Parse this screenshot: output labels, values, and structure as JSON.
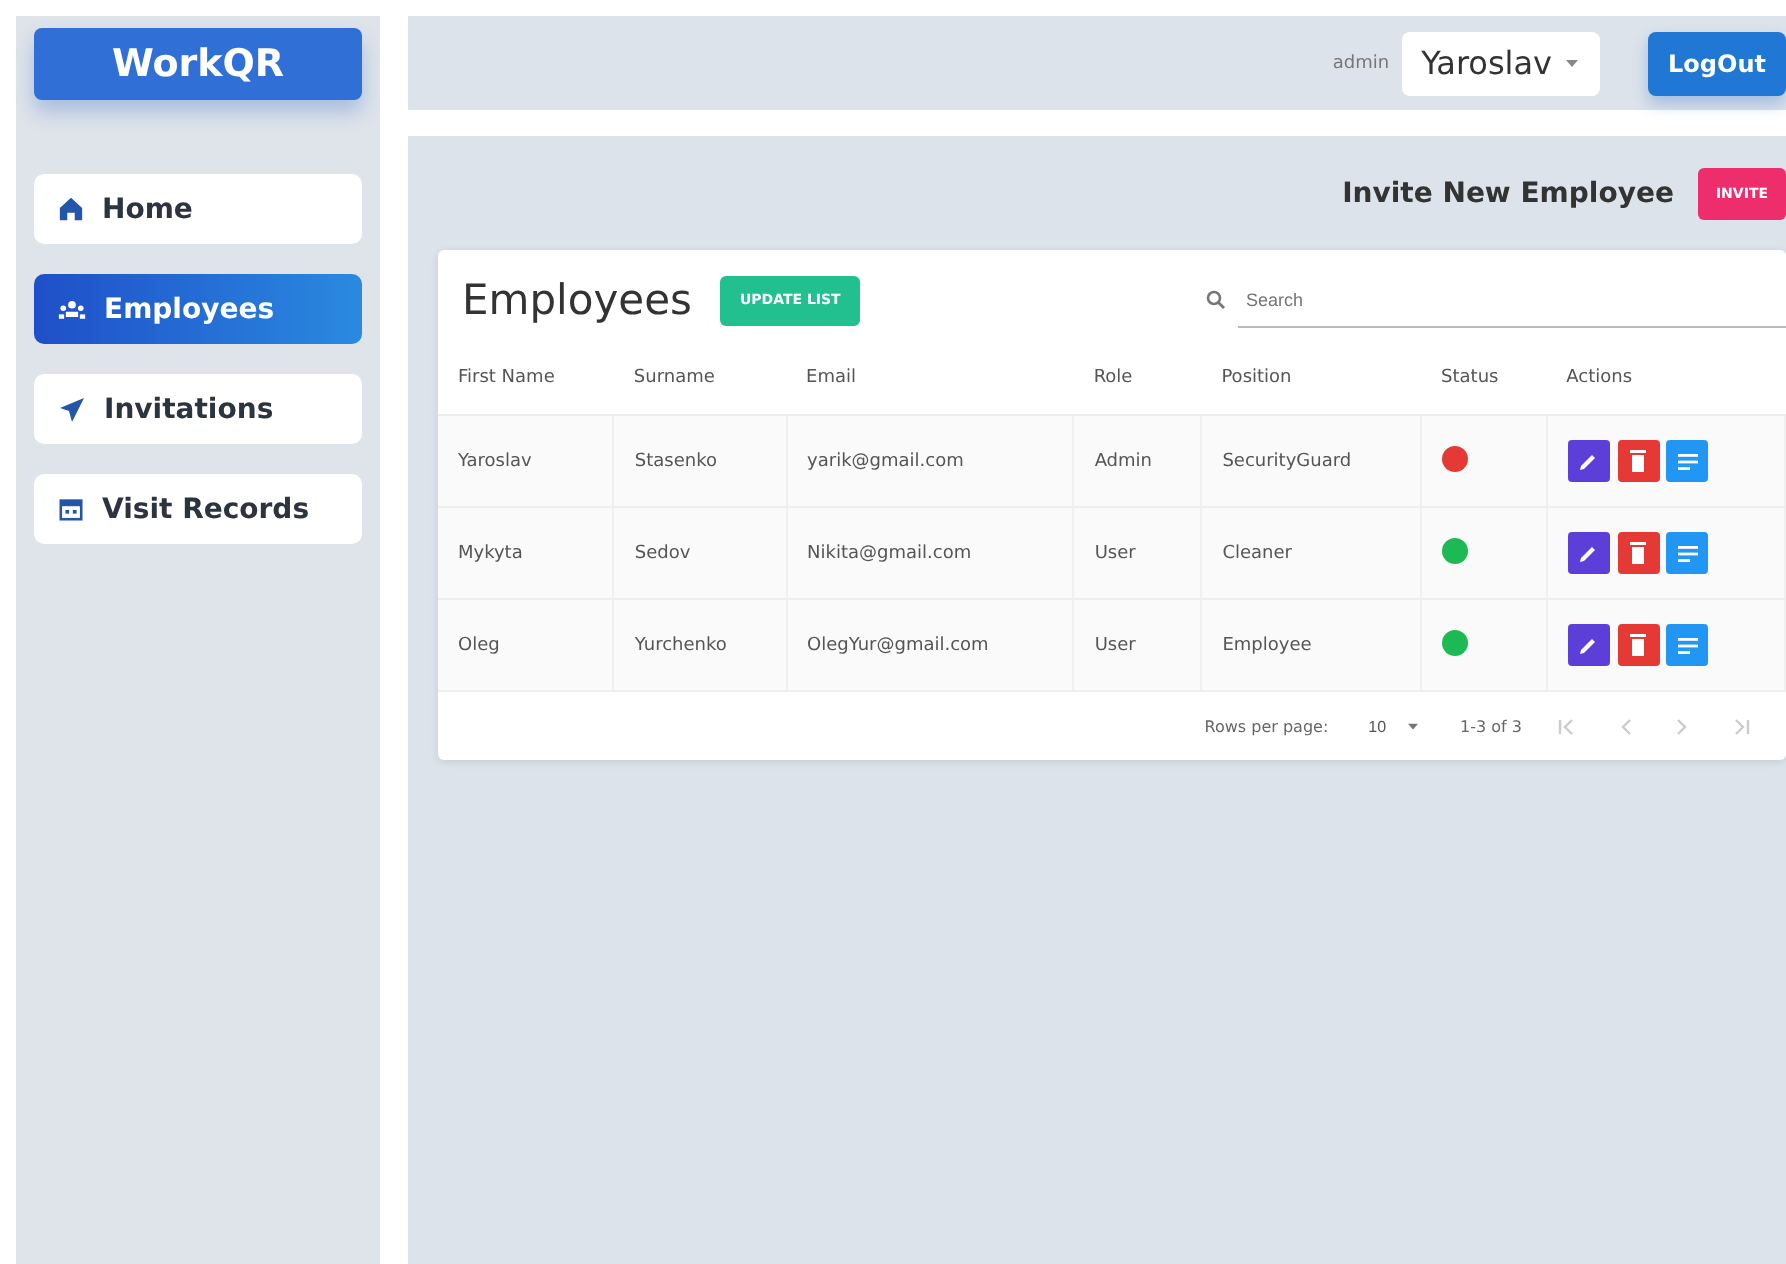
{
  "sidebar": {
    "logo": "WorkQR",
    "items": [
      {
        "label": "Home",
        "selected": false
      },
      {
        "label": "Employees",
        "selected": true
      },
      {
        "label": "Invitations",
        "selected": false
      },
      {
        "label": "Visit Records",
        "selected": false
      }
    ]
  },
  "topbar": {
    "role": "admin",
    "user": "Yaroslav",
    "logout": "LogOut"
  },
  "invite": {
    "label": "Invite New Employee",
    "button": "INVITE"
  },
  "table": {
    "title": "Employees",
    "update_button": "UPDATE LIST",
    "search": {
      "placeholder": "Search"
    },
    "columns": [
      "First Name",
      "Surname",
      "Email",
      "Role",
      "Position",
      "Status",
      "Actions"
    ],
    "rows": [
      {
        "cells": [
          "Yaroslav",
          "Stasenko",
          "yarik@gmail.com",
          "Admin",
          "SecurityGuard"
        ],
        "color": "#e53935"
      },
      {
        "cells": [
          "Mykyta",
          "Sedov",
          "Nikita@gmail.com",
          "User",
          "Cleaner"
        ],
        "color": "#1db954"
      },
      {
        "cells": [
          "Oleg",
          "Yurchenko",
          "OlegYur@gmail.com",
          "User",
          "Employee"
        ],
        "color": "#1db954"
      }
    ],
    "footer": {
      "rows_per_page_label": "Rows per page:",
      "rows_per_page": "10",
      "range": "1-3 of 3"
    }
  }
}
